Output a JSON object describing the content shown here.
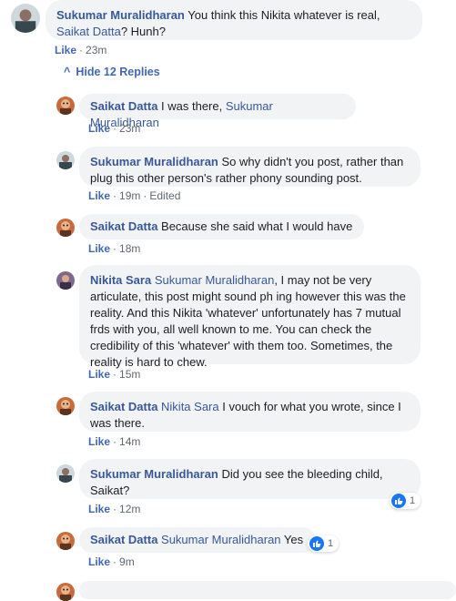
{
  "comments": [
    {
      "name": "Sukumar Muralidharan",
      "text_a": " You think this Nikita whatever is real,",
      "tag": "Saikat Datta",
      "text_b": "? Hunh?",
      "like": "Like",
      "time": "23m"
    }
  ],
  "hide_replies": "Hide 12 Replies",
  "replies": [
    {
      "name": "Saikat Datta",
      "text": " I was there, ",
      "tag": "Sukumar Muralidharan",
      "like": "Like",
      "time": "23m"
    },
    {
      "name": "Sukumar Muralidharan",
      "text": " So why didn't you post, rather than plug this other person's rather phony sounding post.",
      "like": "Like",
      "time": "19m",
      "edited": "Edited"
    },
    {
      "name": "Saikat Datta",
      "text": " Because she said what I would have",
      "like": "Like",
      "time": "18m"
    },
    {
      "name": "Nikita Sara",
      "tag": " Sukumar Muralidharan",
      "text": ", I may not be very articulate, this post might sound ph ing however this was the reality. And this Nikita 'whatever' unfortunately has 7 mutual frds with you, all well known to me. You can check the credibility of this 'whatever' with them too. Sometimes, the reality is hard to chew.",
      "like": "Like",
      "time": "15m"
    },
    {
      "name": "Saikat Datta",
      "tag": " Nikita Sara",
      "text": " I vouch for what you wrote, since I was there.",
      "like": "Like",
      "time": "14m"
    },
    {
      "name": "Sukumar Muralidharan",
      "text": " Did you see the bleeding child, Saikat?",
      "like": "Like",
      "time": "12m",
      "reactions": "1"
    },
    {
      "name": "Saikat Datta",
      "tag": " Sukumar Muralidharan",
      "text": " Yes",
      "like": "Like",
      "time": "9m",
      "reactions": "1"
    }
  ]
}
